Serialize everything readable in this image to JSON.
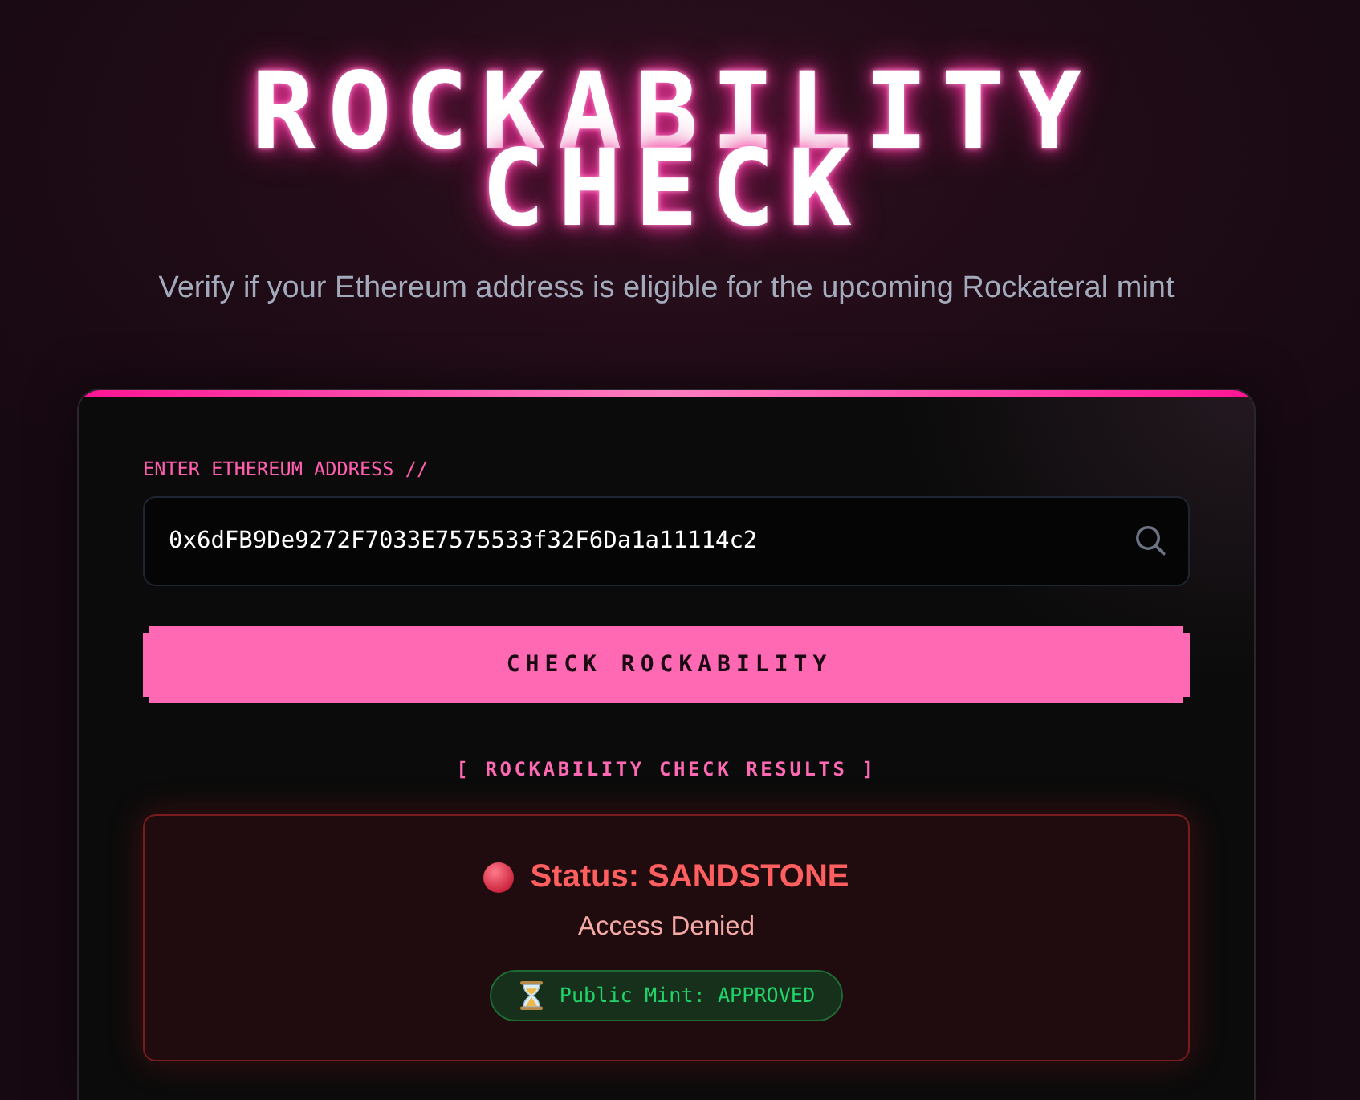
{
  "header": {
    "title": "ROCKABILITY CHECK",
    "subtitle": "Verify if your Ethereum address is eligible for the upcoming Rockateral mint"
  },
  "form": {
    "label": "ENTER ETHEREUM ADDRESS //",
    "address_field": {
      "value": "0x6dFB9De9272F7033E7575533f32F6Da1a11114c2"
    },
    "button": "CHECK ROCKABILITY"
  },
  "results": {
    "heading": "[ ROCKABILITY CHECK RESULTS ]",
    "approved": false,
    "status": "Status: SANDSTONE",
    "message": "Access Denied",
    "badge": {
      "text": "Public Mint: APPROVED",
      "approved": true
    }
  }
}
